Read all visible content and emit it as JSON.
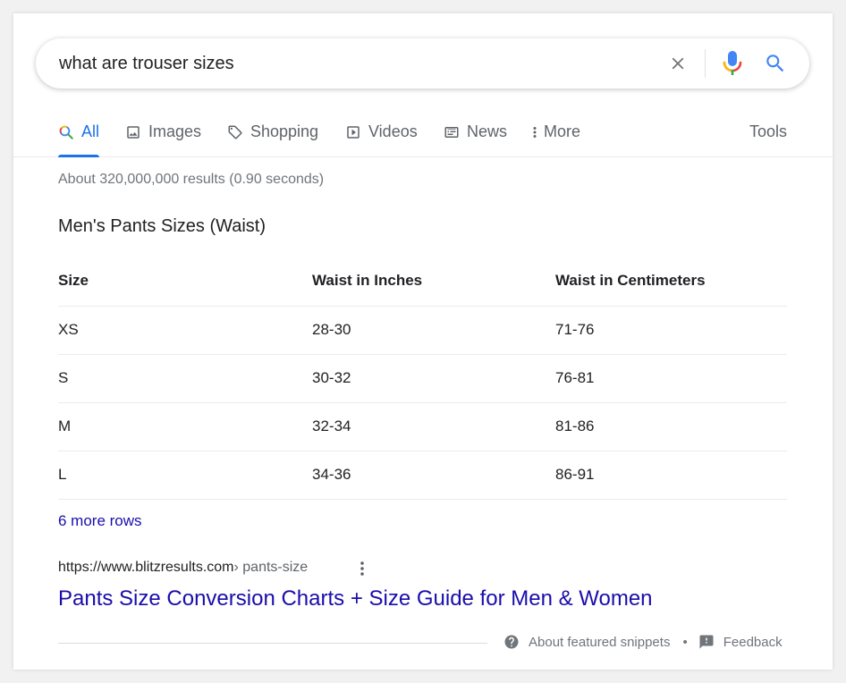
{
  "search": {
    "query": "what are trouser sizes"
  },
  "icons": {
    "clear": "close-icon",
    "mic": "microphone-icon",
    "search": "search-icon"
  },
  "colors": {
    "accent": "#1a73e8",
    "link": "#1a0dab",
    "text": "#202124",
    "muted": "#70757a"
  },
  "tabs": [
    {
      "label": "All",
      "active": true
    },
    {
      "label": "Images"
    },
    {
      "label": "Shopping"
    },
    {
      "label": "Videos"
    },
    {
      "label": "News"
    },
    {
      "label": "More"
    }
  ],
  "tools_label": "Tools",
  "stats": "About 320,000,000 results (0.90 seconds)",
  "snippet": {
    "title": "Men's Pants Sizes (Waist)",
    "headers": [
      "Size",
      "Waist in Inches",
      "Waist in Centimeters"
    ],
    "rows": [
      [
        "XS",
        "28-30",
        "71-76"
      ],
      [
        "S",
        "30-32",
        "76-81"
      ],
      [
        "M",
        "32-34",
        "81-86"
      ],
      [
        "L",
        "34-36",
        "86-91"
      ]
    ],
    "more_rows": "6 more rows"
  },
  "result": {
    "url": "https://www.blitzresults.com",
    "path": " › pants-size",
    "title": "Pants Size Conversion Charts + Size Guide for Men & Women"
  },
  "footer": {
    "about": "About featured snippets",
    "separator": "•",
    "feedback": "Feedback"
  }
}
